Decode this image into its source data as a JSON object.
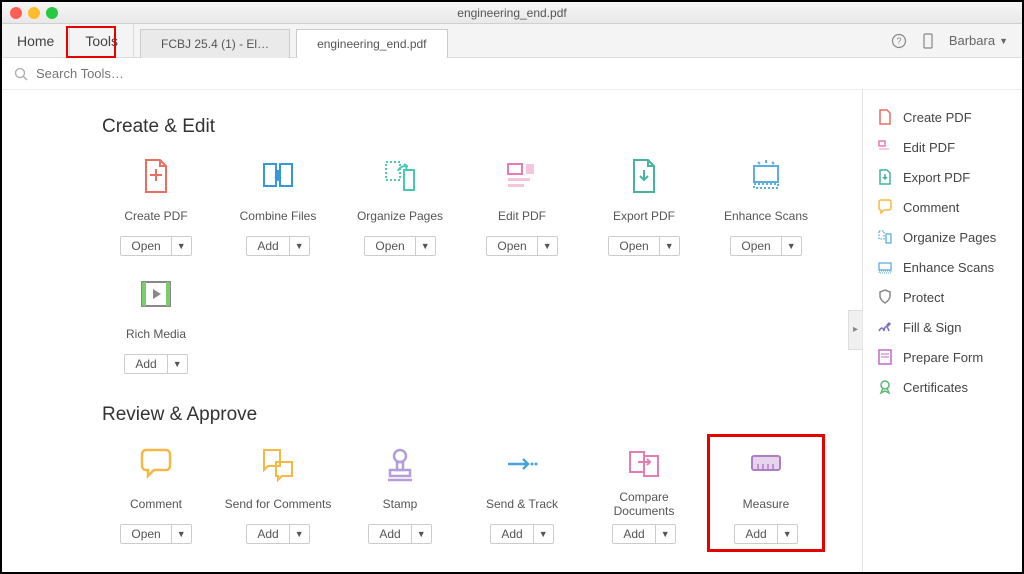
{
  "window_title": "engineering_end.pdf",
  "tabs": {
    "home": "Home",
    "tools": "Tools"
  },
  "doc_tabs": [
    "FCBJ 25.4 (1) - El…",
    "engineering_end.pdf"
  ],
  "user": "Barbara",
  "search_placeholder": "Search Tools…",
  "sections": {
    "create_edit": {
      "title": "Create & Edit",
      "tools": [
        {
          "label": "Create PDF",
          "button": "Open",
          "icon": "create-pdf"
        },
        {
          "label": "Combine Files",
          "button": "Add",
          "icon": "combine"
        },
        {
          "label": "Organize Pages",
          "button": "Open",
          "icon": "organize"
        },
        {
          "label": "Edit PDF",
          "button": "Open",
          "icon": "edit"
        },
        {
          "label": "Export PDF",
          "button": "Open",
          "icon": "export"
        },
        {
          "label": "Enhance Scans",
          "button": "Open",
          "icon": "enhance"
        }
      ],
      "tools_row2": [
        {
          "label": "Rich Media",
          "button": "Add",
          "icon": "richmedia"
        }
      ]
    },
    "review_approve": {
      "title": "Review & Approve",
      "tools": [
        {
          "label": "Comment",
          "button": "Open",
          "icon": "comment"
        },
        {
          "label": "Send for Comments",
          "button": "Add",
          "icon": "sendcomm"
        },
        {
          "label": "Stamp",
          "button": "Add",
          "icon": "stamp"
        },
        {
          "label": "Send & Track",
          "button": "Add",
          "icon": "sendtrack"
        },
        {
          "label": "Compare Documents",
          "button": "Add",
          "icon": "compare"
        },
        {
          "label": "Measure",
          "button": "Add",
          "icon": "measure"
        }
      ]
    }
  },
  "sidebar": [
    {
      "label": "Create PDF",
      "icon": "create-pdf",
      "color": "#ec6d62"
    },
    {
      "label": "Edit PDF",
      "icon": "edit",
      "color": "#e77bb3"
    },
    {
      "label": "Export PDF",
      "icon": "export",
      "color": "#45b39d"
    },
    {
      "label": "Comment",
      "icon": "comment",
      "color": "#f5b942"
    },
    {
      "label": "Organize Pages",
      "icon": "organize",
      "color": "#5dade2"
    },
    {
      "label": "Enhance Scans",
      "icon": "enhance",
      "color": "#5dade2"
    },
    {
      "label": "Protect",
      "icon": "protect",
      "color": "#888"
    },
    {
      "label": "Fill & Sign",
      "icon": "sign",
      "color": "#7d6bc4"
    },
    {
      "label": "Prepare Form",
      "icon": "form",
      "color": "#c368c9"
    },
    {
      "label": "Certificates",
      "icon": "cert",
      "color": "#5cb874"
    }
  ]
}
